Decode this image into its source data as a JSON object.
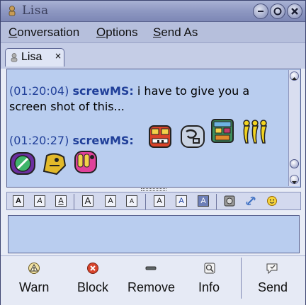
{
  "window": {
    "title": "Lisa"
  },
  "menubar": {
    "items": [
      "Conversation",
      "Options",
      "Send As"
    ],
    "mnemonics": [
      "C",
      "O",
      "S"
    ]
  },
  "tabs": [
    {
      "label": "Lisa",
      "close": "×"
    }
  ],
  "conversation": {
    "messages": [
      {
        "time": "(01:20:04)",
        "sender": "screwMS:",
        "text": " i have to give you a screen shot of this..."
      },
      {
        "time": "(01:20:27)",
        "sender": "screwMS:",
        "emoticons": [
          "mayan-glyph-face",
          "mayan-glyph-stone",
          "mayan-glyph-mask",
          "yellow-stick-figures",
          "green-glyph",
          "yellow-head",
          "pink-hand-glyph"
        ]
      }
    ]
  },
  "format_toolbar": {
    "font_buttons": [
      "A",
      "A",
      "A",
      "A",
      "A",
      "A",
      "A",
      "A",
      "A"
    ],
    "icons": [
      "smiley-insert-icon",
      "link-icon",
      "smiley-face-icon"
    ]
  },
  "buttons": [
    {
      "label": "Warn",
      "icon": "warning-icon"
    },
    {
      "label": "Block",
      "icon": "block-icon"
    },
    {
      "label": "Remove",
      "icon": "remove-icon"
    },
    {
      "label": "Info",
      "icon": "info-icon"
    },
    {
      "label": "Send",
      "icon": "send-icon"
    }
  ],
  "colors": {
    "accent": "#203f99",
    "conversation_bg": "#b9cdef",
    "titlebar": "#8e98c2"
  }
}
